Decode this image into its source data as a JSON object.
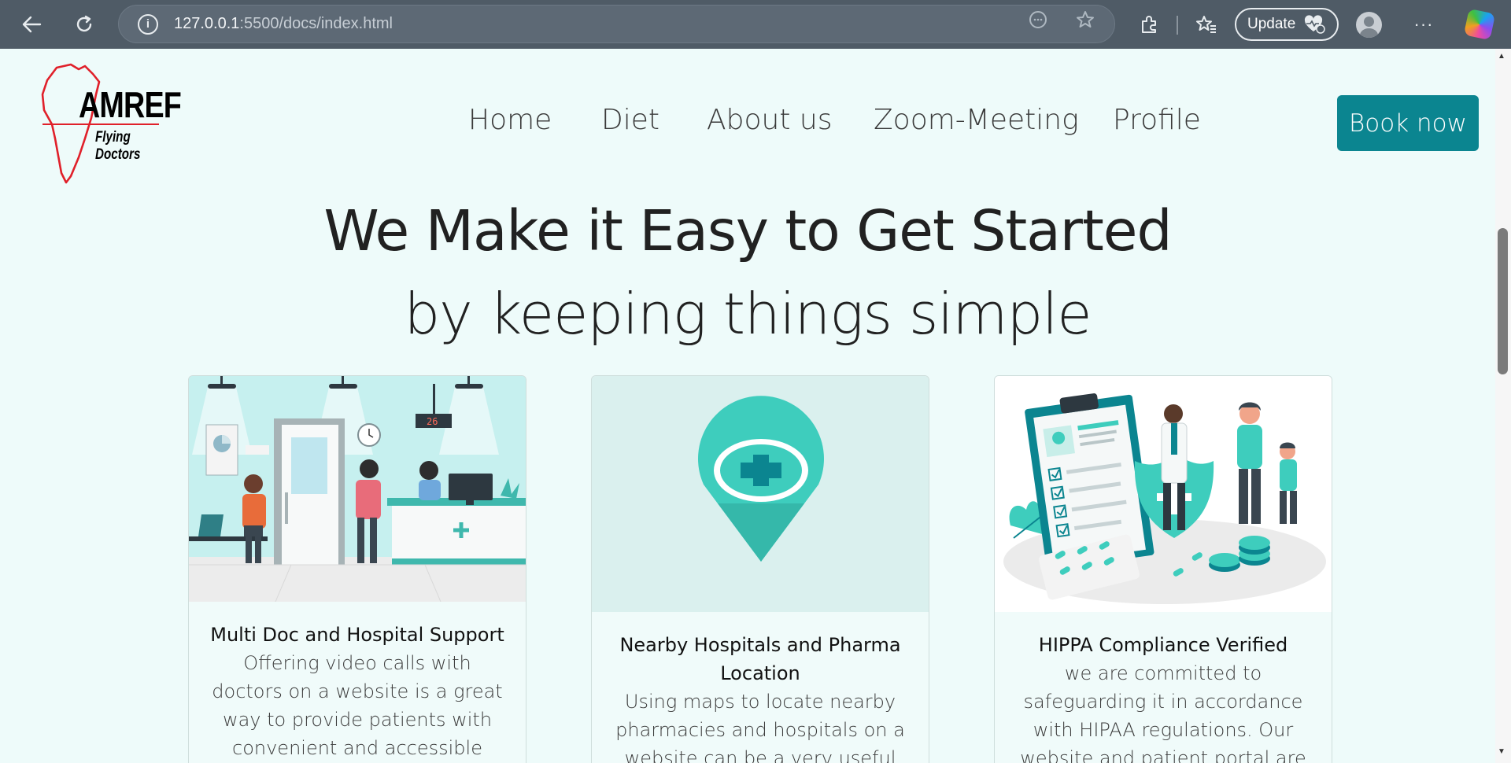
{
  "browser": {
    "url_host": "127.0.0.1",
    "url_rest": ":5500/docs/index.html",
    "update_label": "Update"
  },
  "site": {
    "logo_line1": "AMREF",
    "logo_line2": "Flying Doctors",
    "nav": [
      "Home",
      "Diet",
      "About us",
      "Zoom-Meeting",
      "Profile"
    ],
    "book_label": "Book now"
  },
  "hero": {
    "title": "We Make it Easy to Get Started",
    "subtitle": "by keeping things simple"
  },
  "cards": [
    {
      "title": "Multi Doc and Hospital Support",
      "text": "Offering video calls with doctors on a website is a great way to provide patients with convenient and accessible medical care. Video calls"
    },
    {
      "title": "Nearby Hospitals and Pharma Location",
      "text": "Using maps to locate nearby pharmacies and hospitals on a website can be a very useful feature"
    },
    {
      "title": "HIPPA Compliance Verified",
      "text": "we are committed to safeguarding it in accordance with HIPAA regulations. Our website and patient portal are also designed with HIPAA"
    }
  ],
  "illustration": {
    "counter_number": "26"
  },
  "colors": {
    "accent": "#0b8590",
    "teal_light": "#3ecdbd",
    "page_bg": "#eefbfa",
    "browser_bar": "#4f5b66"
  }
}
